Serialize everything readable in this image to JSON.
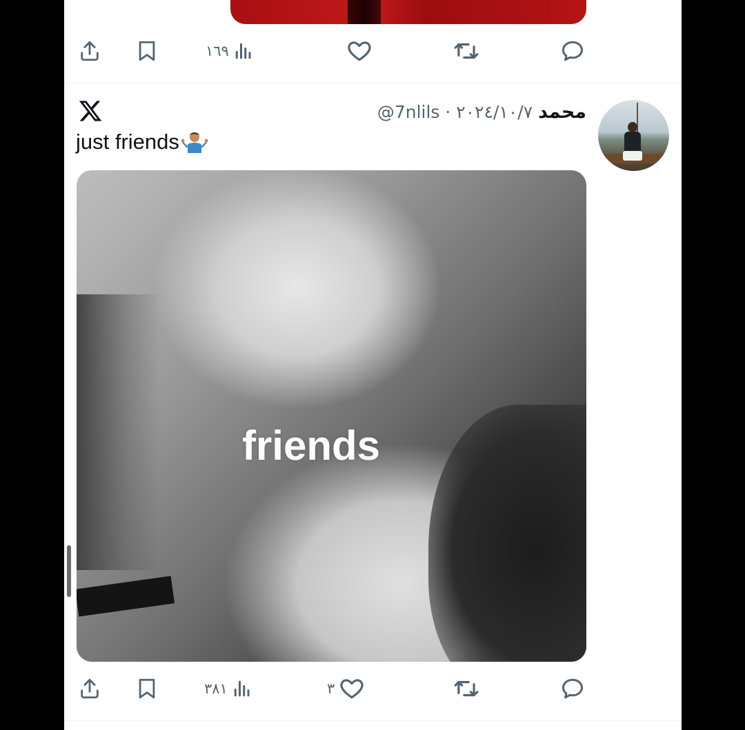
{
  "previous_tweet": {
    "views_count": "١٦٩"
  },
  "tweet": {
    "author": {
      "display_name": "محمد",
      "handle_and_date": "@7nlils · ٢٠٢٤/١٠/٧"
    },
    "text": "just friends",
    "emoji": "person-shrugging",
    "media": {
      "overlay_text": "friends"
    },
    "actions": {
      "views_count": "٣٨١",
      "likes_count": "٣"
    }
  },
  "colors": {
    "icon_gray": "#536471",
    "text_dark": "#0f1419",
    "background": "#ffffff",
    "frame": "#000000"
  }
}
